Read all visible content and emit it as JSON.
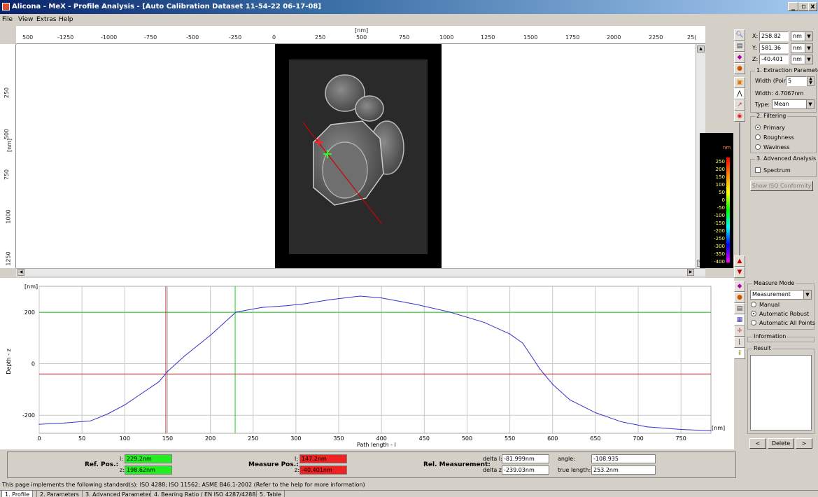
{
  "window": {
    "title": "Alicona - MeX - Profile Analysis - [Auto Calibration Dataset 11-54-22 06-17-08]"
  },
  "menu": [
    "File",
    "View",
    "Extras",
    "Help"
  ],
  "top_ruler": {
    "unit": "[nm]",
    "ticks": [
      "500",
      "-1250",
      "-1000",
      "-750",
      "-500",
      "-250",
      "0",
      "250",
      "500",
      "750",
      "1000",
      "1250",
      "1500",
      "1750",
      "2000",
      "2250",
      "25("
    ]
  },
  "left_ruler": {
    "unit": "[nm]",
    "ticks": [
      "250",
      "500",
      "750",
      "1000",
      "1250"
    ]
  },
  "colorbar": {
    "unit": "nm",
    "labels": [
      "250",
      "200",
      "150",
      "100",
      "50",
      "0",
      "-50",
      "-100",
      "-150",
      "-200",
      "-250",
      "-300",
      "-350",
      "-400"
    ]
  },
  "coords": {
    "x": "258.82",
    "y": "581.36",
    "z": "-40.401",
    "unit": "nm",
    "x_label": "X:",
    "y_label": "Y:",
    "z_label": "Z:"
  },
  "extraction": {
    "group": "1. Extraction Paramete",
    "width_label": "Width (Poin",
    "width_value": "5",
    "width_readout": "Width: 4.7067nm",
    "type_label": "Type:",
    "type_value": "Mean"
  },
  "filtering": {
    "group": "2. Filtering",
    "options": [
      "Primary",
      "Roughness",
      "Waviness"
    ]
  },
  "advanced": {
    "group": "3. Advanced Analysis",
    "spectrum": "Spectrum",
    "iso_button": "Show ISO Conformity"
  },
  "measure_mode": {
    "group": "Measure Mode",
    "value": "Measurement",
    "options": [
      "Manual",
      "Automatic Robust",
      "Automatic All Points"
    ],
    "information": "Information",
    "result": "Result",
    "prev": "<",
    "delete": "Delete",
    "next": ">"
  },
  "chart_data": {
    "type": "line",
    "xlabel": "Path length - l",
    "ylabel": "Depth - z",
    "x_unit": "[nm]",
    "y_unit": "[nm]",
    "xlim": [
      0,
      785
    ],
    "ylim": [
      -270,
      300
    ],
    "x_ticks": [
      0,
      50,
      100,
      150,
      200,
      250,
      300,
      350,
      400,
      450,
      500,
      550,
      600,
      650,
      700,
      750
    ],
    "y_ticks": [
      -200,
      0,
      200
    ],
    "grid": true,
    "x": [
      0,
      30,
      60,
      80,
      100,
      120,
      140,
      150,
      170,
      200,
      230,
      260,
      290,
      310,
      340,
      375,
      400,
      440,
      480,
      520,
      550,
      565,
      585,
      600,
      620,
      650,
      680,
      710,
      750,
      785
    ],
    "y": [
      -235,
      -230,
      -222,
      -195,
      -160,
      -115,
      -70,
      -30,
      30,
      110,
      200,
      218,
      225,
      232,
      248,
      262,
      255,
      230,
      200,
      160,
      115,
      80,
      -20,
      -80,
      -140,
      -190,
      -225,
      -245,
      -255,
      -260
    ],
    "ref_x": 148,
    "ref_z": -40,
    "meas_x": 229,
    "meas_z": 199
  },
  "measurements": {
    "ref_label": "Ref. Pos.:",
    "meas_label": "Measure Pos.:",
    "rel_label": "Rel. Measurement:",
    "ref_l_label": "l:",
    "ref_l": "229.2nm",
    "ref_z_label": "z:",
    "ref_z": "198.62nm",
    "meas_l_label": "l:",
    "meas_l": "147.2nm",
    "meas_z_label": "z:",
    "meas_z": "-40.401nm",
    "delta_l_label": "delta l:",
    "delta_l": "-81.999nm",
    "delta_z_label": "delta z:",
    "delta_z": "-239.03nm",
    "angle_label": "angle:",
    "angle": "-108.935",
    "true_length_label": "true length:",
    "true_length": "253.2nm"
  },
  "status": "This page implements the following standard(s): ISO 4288; ISO 11562; ASME B46.1-2002 (Refer to the help for more information)",
  "tabs": [
    "1. Profile",
    "2. Parameters",
    "3. Advanced Parameters",
    "4. Bearing Ratio / EN ISO 4287/4288",
    "5. Table"
  ],
  "colors": {
    "profile": "#3333cc",
    "ref_line": "#cc2222",
    "meas_line": "#22cc22",
    "ref_field": "#22ee22",
    "meas_field": "#ee2222"
  }
}
